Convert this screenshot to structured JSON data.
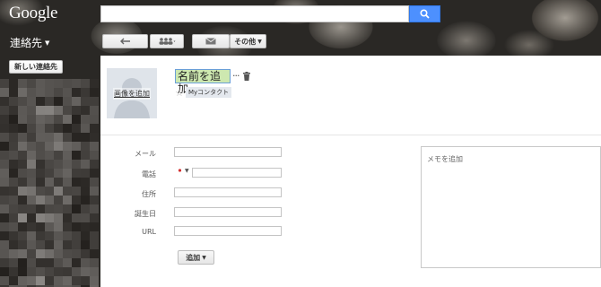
{
  "header": {
    "logo": "Google",
    "search": {
      "value": "",
      "icon": "search-icon"
    }
  },
  "app_title": "連絡先",
  "toolbar": {
    "back_icon": "back-arrow-icon",
    "people_icon": "people-icon",
    "mail_icon": "mail-icon",
    "more_label": "その他"
  },
  "sidebar": {
    "new_contact_label": "新しい連絡先"
  },
  "contact": {
    "photo_label": "画像を追加",
    "name": "名前を追加",
    "name_more": "···",
    "group_label": "Myコンタクト"
  },
  "form": {
    "fields": [
      {
        "label": "メール",
        "value": ""
      },
      {
        "label": "電話",
        "value": ""
      },
      {
        "label": "住所",
        "value": ""
      },
      {
        "label": "誕生日",
        "value": ""
      },
      {
        "label": "URL",
        "value": ""
      }
    ],
    "add_label": "追加",
    "notes_placeholder": "メモを追加"
  },
  "colors": {
    "search_button": "#4d90fe",
    "name_highlight": "#cde8b0",
    "group_chip": "#e4e8ee"
  }
}
